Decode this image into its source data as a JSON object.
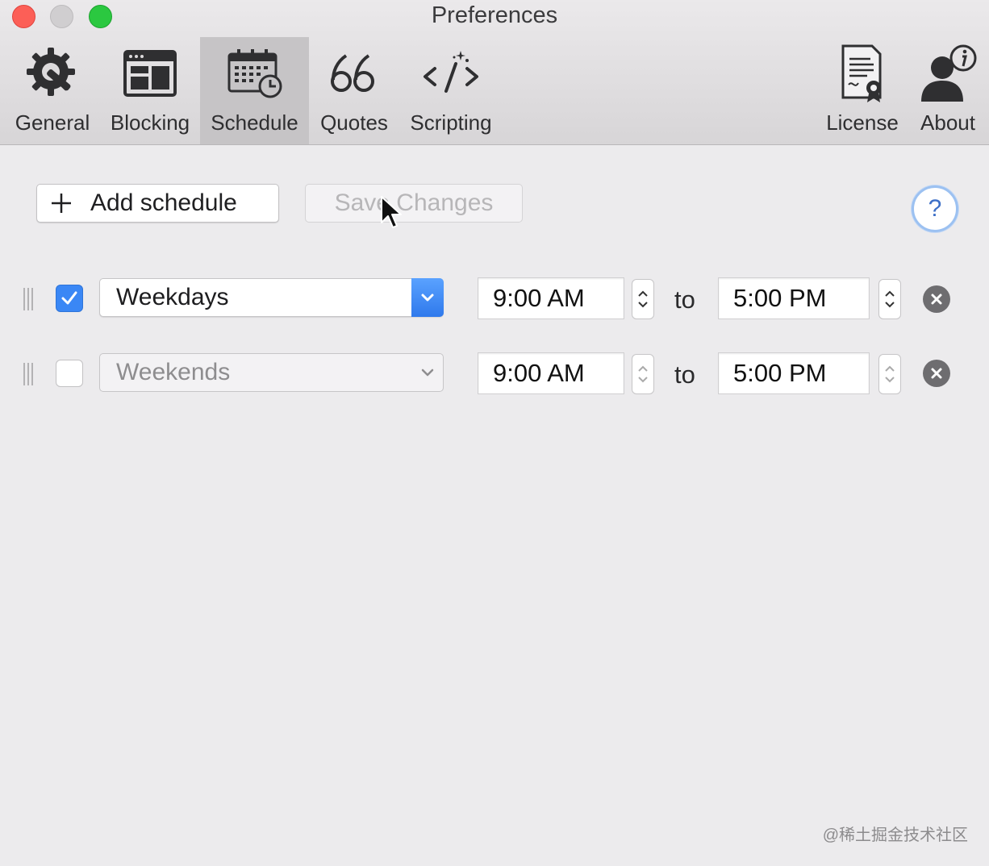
{
  "window": {
    "title": "Preferences"
  },
  "toolbar": {
    "items": [
      {
        "label": "General",
        "icon": "gear-wrench-icon"
      },
      {
        "label": "Blocking",
        "icon": "browser-window-icon"
      },
      {
        "label": "Schedule",
        "icon": "calendar-clock-icon",
        "active": true
      },
      {
        "label": "Quotes",
        "icon": "quote-marks-icon"
      },
      {
        "label": "Scripting",
        "icon": "code-brackets-icon"
      },
      {
        "label": "License",
        "icon": "certificate-icon"
      },
      {
        "label": "About",
        "icon": "person-info-icon"
      }
    ]
  },
  "actions": {
    "add_label": "Add schedule",
    "save_label": "Save Changes",
    "save_enabled": false,
    "help_glyph": "?"
  },
  "schedules": [
    {
      "enabled": true,
      "days": "Weekdays",
      "start": "9:00 AM",
      "connector": "to",
      "end": "5:00 PM"
    },
    {
      "enabled": false,
      "days": "Weekends",
      "start": "9:00 AM",
      "connector": "to",
      "end": "5:00 PM"
    }
  ],
  "footer": {
    "watermark": "@稀土掘金技术社区"
  },
  "colors": {
    "accent": "#3a87f5",
    "close": "#fc5f57",
    "zoom": "#2bc840",
    "help_ring": "#9cc1f1"
  }
}
